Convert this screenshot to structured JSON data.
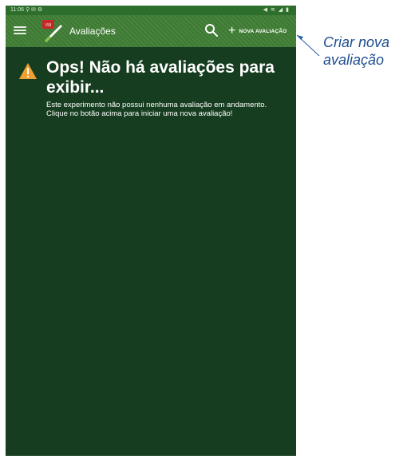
{
  "status_bar": {
    "time": "11:06",
    "left_icons": "⚲ ✉ ⚙",
    "right_icons": "◀ ≋ ◢ ▮"
  },
  "app_bar": {
    "title": "Avaliações",
    "new_button_label": "NOVA AVALIAÇÃO",
    "plus_glyph": "+",
    "logo_text": "VIII"
  },
  "empty_state": {
    "title": "Ops! Não há avaliações para exibir...",
    "description": "Este experimento não possui nenhuma avaliação em andamento. Clique no botão acima para iniciar uma nova avaliação!"
  },
  "annotation": {
    "text": "Criar nova avaliação"
  },
  "icons": {
    "menu": "menu-icon",
    "search": "search-icon",
    "warning": "warning-icon",
    "logo": "app-logo-icon"
  },
  "colors": {
    "background": "#173d20",
    "app_bar": "#3f7d34",
    "warning": "#f0a030",
    "annotation": "#1f4e8f"
  }
}
